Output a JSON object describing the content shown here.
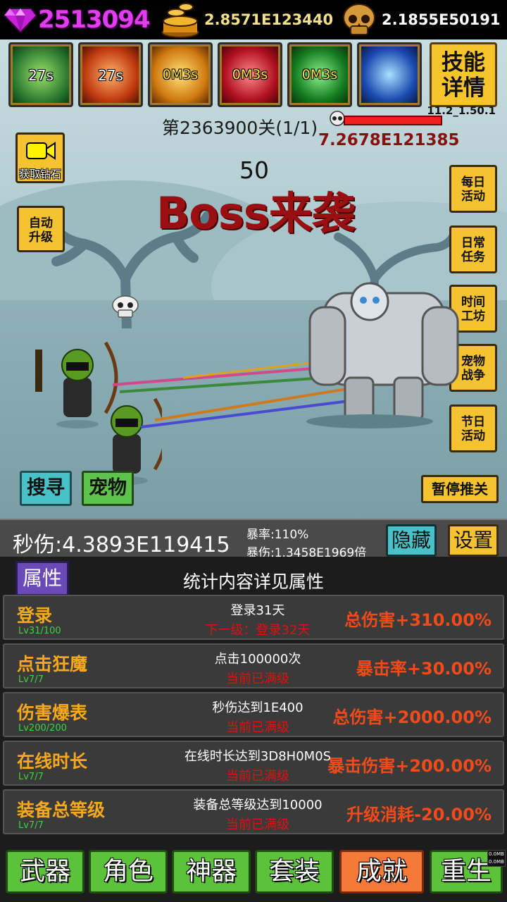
{
  "resources": {
    "gems": "2513094",
    "gold": "2.8571E123440",
    "souls": "2.1855E50191"
  },
  "skills": [
    {
      "icon": "green-slash-skill-icon",
      "cd": "27s"
    },
    {
      "icon": "red-fire-skill-icon",
      "cd": "27s"
    },
    {
      "icon": "star-skill-icon",
      "cd": "0M3s"
    },
    {
      "icon": "rage-skill-icon",
      "cd": "0M3s"
    },
    {
      "icon": "bow-skill-icon",
      "cd": "0M3s"
    },
    {
      "icon": "lightning-skill-icon",
      "cd": ""
    }
  ],
  "skill_detail_label": "技能\n详情",
  "version": "11.2_1.50.1",
  "stage": "第2363900关(1/1)",
  "boss_hp": "7.2678E121385",
  "video_button_label": "获取钻石",
  "auto_upgrade_label": "自动\n升级",
  "wave_count": "50",
  "boss_title": "Boss来袭",
  "right_menu": [
    {
      "label": "每日\n活动"
    },
    {
      "label": "日常\n任务"
    },
    {
      "label": "时间\n工坊"
    },
    {
      "label": "宠物\n战争"
    },
    {
      "label": "节日\n活动"
    }
  ],
  "search_label": "搜寻",
  "pet_label": "宠物",
  "pause_label": "暂停推关",
  "stats": {
    "dps": "秒伤:4.3893E119415",
    "crit_rate": "暴率:110%",
    "crit_damage": "暴伤:1.3458E1969倍",
    "hide_label": "隐藏",
    "settings_label": "设置"
  },
  "panel": {
    "tab_label": "属性",
    "hint": "统计内容详见属性",
    "achievements": [
      {
        "name": "登录",
        "level": "Lv31/100",
        "desc": "登录31天",
        "next": "下一级：登录32天",
        "bonus": "总伤害+310.00%"
      },
      {
        "name": "点击狂魔",
        "level": "Lv7/7",
        "desc": "点击100000次",
        "next": "当前已满级",
        "bonus": "暴击率+30.00%"
      },
      {
        "name": "伤害爆表",
        "level": "Lv200/200",
        "desc": "秒伤达到1E400",
        "next": "当前已满级",
        "bonus": "总伤害+2000.00%"
      },
      {
        "name": "在线时长",
        "level": "Lv7/7",
        "desc": "在线时长达到3D8H0M0S",
        "next": "当前已满级",
        "bonus": "暴击伤害+200.00%"
      },
      {
        "name": "装备总等级",
        "level": "Lv7/7",
        "desc": "装备总等级达到10000",
        "next": "当前已满级",
        "bonus": "升级消耗-20.00%"
      }
    ]
  },
  "nav": [
    {
      "label": "武器",
      "active": false
    },
    {
      "label": "角色",
      "active": false
    },
    {
      "label": "神器",
      "active": false
    },
    {
      "label": "套装",
      "active": false
    },
    {
      "label": "成就",
      "active": true
    },
    {
      "label": "重生",
      "active": false
    }
  ],
  "mem_tag": "0.0MB\n0.0MB",
  "colors": {
    "gem": "#e23cf0",
    "gold_text": "#f3e08a",
    "button_yellow": "#f5c230",
    "button_green": "#5bc23a",
    "button_cyan": "#48c1c9",
    "active_tab": "#f57a3a",
    "achievement_name": "#f7a81c",
    "bonus_text": "#f34a1a",
    "boss_title": "#9a0f12"
  }
}
